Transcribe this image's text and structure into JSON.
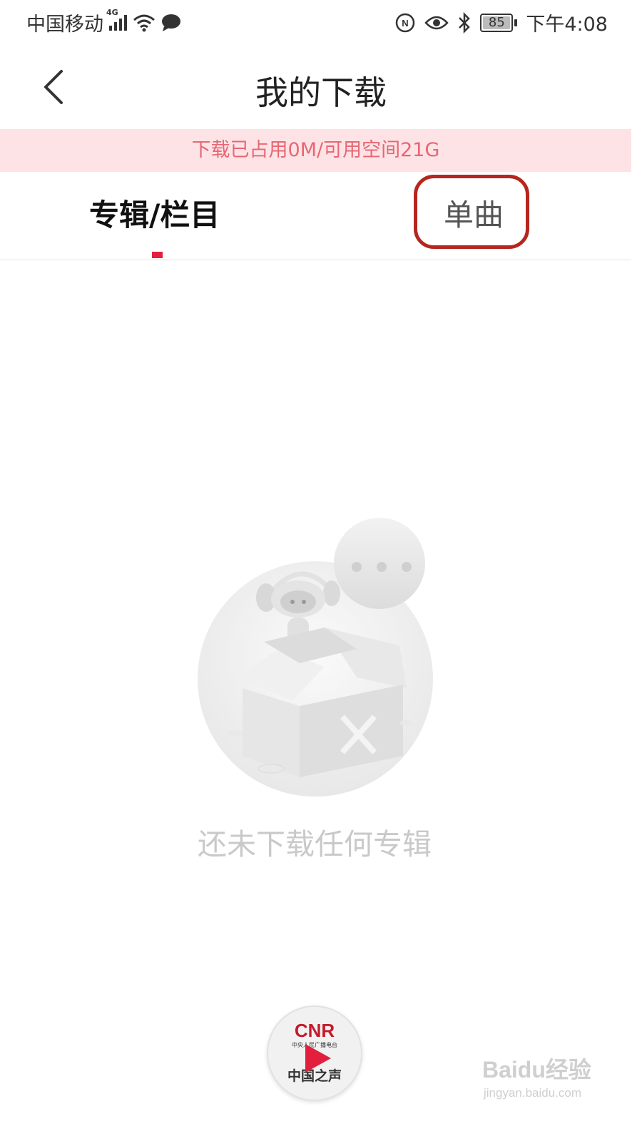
{
  "status_bar": {
    "carrier": "中国移动",
    "network": "4G",
    "battery_level": "85",
    "time": "下午4:08",
    "icons": [
      "signal-icon",
      "wifi-icon",
      "message-icon",
      "nfc-icon",
      "eye-icon",
      "bluetooth-icon",
      "battery-icon"
    ]
  },
  "header": {
    "title": "我的下载",
    "back_icon": "chevron-left-icon"
  },
  "storage": {
    "text": "下载已占用0M/可用空间21G"
  },
  "tabs": [
    {
      "label": "专辑/栏目",
      "active": true
    },
    {
      "label": "单曲",
      "active": false
    }
  ],
  "empty_state": {
    "message": "还未下载任何专辑"
  },
  "player": {
    "logo": "CNR",
    "logo_subtitle": "中央人民广播电台",
    "station": "中国之声",
    "play_icon": "play-icon"
  },
  "watermark": {
    "brand": "Baidu经验",
    "url": "jingyan.baidu.com"
  },
  "colors": {
    "accent": "#e2203e",
    "banner_bg": "#fde3e6",
    "banner_text": "#e86673",
    "annotation_ring": "#b5261e",
    "empty_text": "#c9c9c9"
  }
}
